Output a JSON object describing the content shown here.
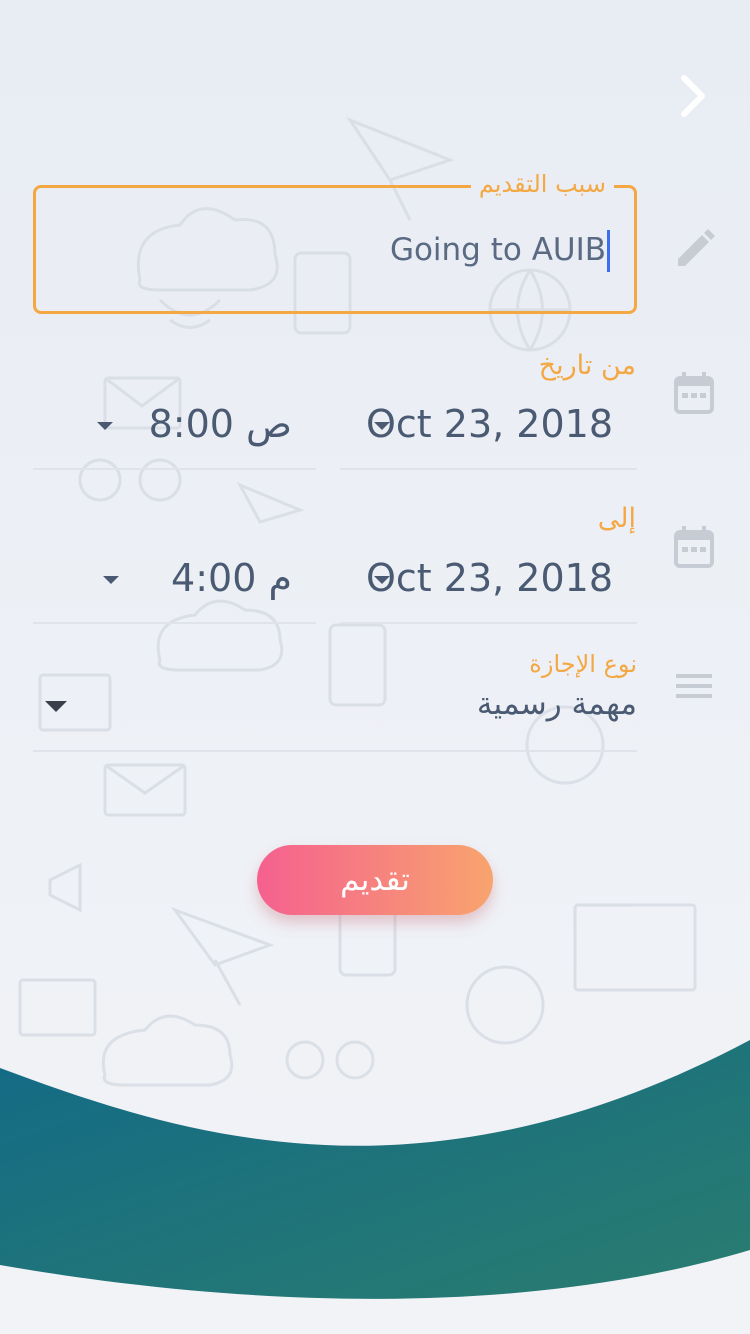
{
  "colors": {
    "accent": "#f4a843",
    "text": "#4a5a72",
    "icon": "#c7ccd4",
    "caret": "#3b6ef0",
    "button_start": "#f5608f",
    "button_end": "#f8a46e",
    "wave_start": "#136a86",
    "wave_end": "#2a7d6f"
  },
  "header": {
    "back_icon": "chevron-right-icon"
  },
  "reason": {
    "label": "سبب التقديم",
    "value": "Going to AUIB",
    "icon": "pencil-icon"
  },
  "from": {
    "label": "من تاريخ",
    "date": "Oct 23, 2018",
    "time": "8:00 ص",
    "icon": "calendar-icon"
  },
  "to": {
    "label": "إلى",
    "date": "Oct 23, 2018",
    "time": "4:00 م",
    "icon": "calendar-icon"
  },
  "leave_type": {
    "label": "نوع الإجازة",
    "value": "مهمة رسمية",
    "icon": "menu-icon"
  },
  "submit": {
    "label": "تقديم"
  }
}
